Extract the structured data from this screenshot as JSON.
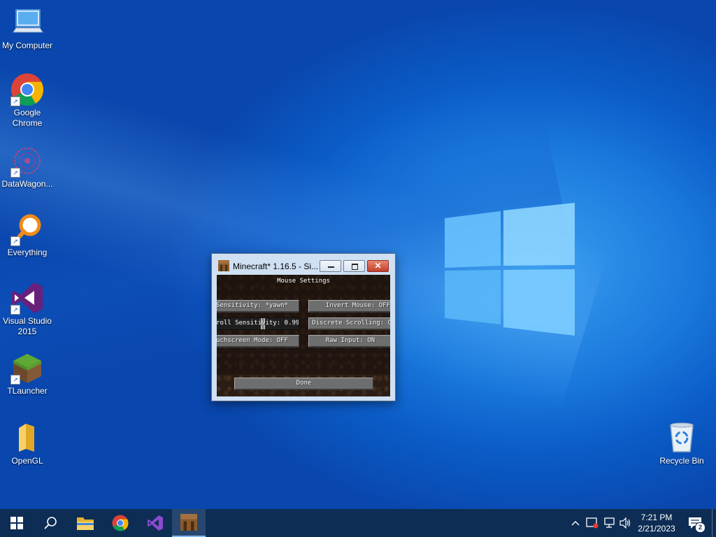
{
  "desktop_icons": [
    {
      "label": "My Computer"
    },
    {
      "label": "Google Chrome"
    },
    {
      "label": "DataWagon..."
    },
    {
      "label": "Everything"
    },
    {
      "label": "Visual Studio 2015"
    },
    {
      "label": "TLauncher"
    },
    {
      "label": "OpenGL"
    },
    {
      "label": "Recycle Bin"
    }
  ],
  "window": {
    "title": "Minecraft* 1.16.5 - Si...",
    "heading": "Mouse Settings",
    "buttons": {
      "sensitivity": "Sensitivity: *yawn*",
      "invert_mouse": "Invert Mouse: OFF",
      "scroll_sensitivity": "roll Sensitivity: 0.99",
      "discrete_scrolling": "Discrete Scrolling: O",
      "touchscreen": "uchscreen Mode: OFF",
      "raw_input": "Raw Input: ON",
      "done": "Done"
    },
    "scroll_sensitivity_value": 0.99
  },
  "taskbar": {
    "time": "7:21 PM",
    "date": "2/21/2023",
    "notification_count": "2",
    "icons": [
      "windows-start-icon",
      "search-icon",
      "file-explorer-icon",
      "chrome-icon",
      "visual-studio-icon",
      "minecraft-icon"
    ]
  }
}
